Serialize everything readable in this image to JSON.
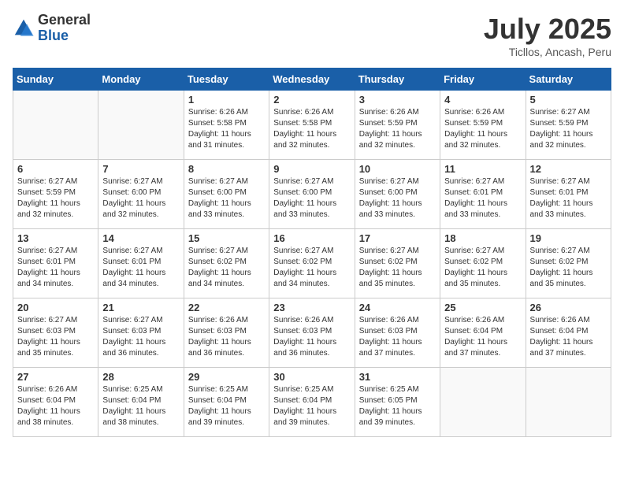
{
  "header": {
    "logo": {
      "general": "General",
      "blue": "Blue"
    },
    "title": "July 2025",
    "subtitle": "Ticllos, Ancash, Peru"
  },
  "calendar": {
    "days_of_week": [
      "Sunday",
      "Monday",
      "Tuesday",
      "Wednesday",
      "Thursday",
      "Friday",
      "Saturday"
    ],
    "weeks": [
      [
        {
          "day": "",
          "info": ""
        },
        {
          "day": "",
          "info": ""
        },
        {
          "day": "1",
          "info": "Sunrise: 6:26 AM\nSunset: 5:58 PM\nDaylight: 11 hours and 31 minutes."
        },
        {
          "day": "2",
          "info": "Sunrise: 6:26 AM\nSunset: 5:58 PM\nDaylight: 11 hours and 32 minutes."
        },
        {
          "day": "3",
          "info": "Sunrise: 6:26 AM\nSunset: 5:59 PM\nDaylight: 11 hours and 32 minutes."
        },
        {
          "day": "4",
          "info": "Sunrise: 6:26 AM\nSunset: 5:59 PM\nDaylight: 11 hours and 32 minutes."
        },
        {
          "day": "5",
          "info": "Sunrise: 6:27 AM\nSunset: 5:59 PM\nDaylight: 11 hours and 32 minutes."
        }
      ],
      [
        {
          "day": "6",
          "info": "Sunrise: 6:27 AM\nSunset: 5:59 PM\nDaylight: 11 hours and 32 minutes."
        },
        {
          "day": "7",
          "info": "Sunrise: 6:27 AM\nSunset: 6:00 PM\nDaylight: 11 hours and 32 minutes."
        },
        {
          "day": "8",
          "info": "Sunrise: 6:27 AM\nSunset: 6:00 PM\nDaylight: 11 hours and 33 minutes."
        },
        {
          "day": "9",
          "info": "Sunrise: 6:27 AM\nSunset: 6:00 PM\nDaylight: 11 hours and 33 minutes."
        },
        {
          "day": "10",
          "info": "Sunrise: 6:27 AM\nSunset: 6:00 PM\nDaylight: 11 hours and 33 minutes."
        },
        {
          "day": "11",
          "info": "Sunrise: 6:27 AM\nSunset: 6:01 PM\nDaylight: 11 hours and 33 minutes."
        },
        {
          "day": "12",
          "info": "Sunrise: 6:27 AM\nSunset: 6:01 PM\nDaylight: 11 hours and 33 minutes."
        }
      ],
      [
        {
          "day": "13",
          "info": "Sunrise: 6:27 AM\nSunset: 6:01 PM\nDaylight: 11 hours and 34 minutes."
        },
        {
          "day": "14",
          "info": "Sunrise: 6:27 AM\nSunset: 6:01 PM\nDaylight: 11 hours and 34 minutes."
        },
        {
          "day": "15",
          "info": "Sunrise: 6:27 AM\nSunset: 6:02 PM\nDaylight: 11 hours and 34 minutes."
        },
        {
          "day": "16",
          "info": "Sunrise: 6:27 AM\nSunset: 6:02 PM\nDaylight: 11 hours and 34 minutes."
        },
        {
          "day": "17",
          "info": "Sunrise: 6:27 AM\nSunset: 6:02 PM\nDaylight: 11 hours and 35 minutes."
        },
        {
          "day": "18",
          "info": "Sunrise: 6:27 AM\nSunset: 6:02 PM\nDaylight: 11 hours and 35 minutes."
        },
        {
          "day": "19",
          "info": "Sunrise: 6:27 AM\nSunset: 6:02 PM\nDaylight: 11 hours and 35 minutes."
        }
      ],
      [
        {
          "day": "20",
          "info": "Sunrise: 6:27 AM\nSunset: 6:03 PM\nDaylight: 11 hours and 35 minutes."
        },
        {
          "day": "21",
          "info": "Sunrise: 6:27 AM\nSunset: 6:03 PM\nDaylight: 11 hours and 36 minutes."
        },
        {
          "day": "22",
          "info": "Sunrise: 6:26 AM\nSunset: 6:03 PM\nDaylight: 11 hours and 36 minutes."
        },
        {
          "day": "23",
          "info": "Sunrise: 6:26 AM\nSunset: 6:03 PM\nDaylight: 11 hours and 36 minutes."
        },
        {
          "day": "24",
          "info": "Sunrise: 6:26 AM\nSunset: 6:03 PM\nDaylight: 11 hours and 37 minutes."
        },
        {
          "day": "25",
          "info": "Sunrise: 6:26 AM\nSunset: 6:04 PM\nDaylight: 11 hours and 37 minutes."
        },
        {
          "day": "26",
          "info": "Sunrise: 6:26 AM\nSunset: 6:04 PM\nDaylight: 11 hours and 37 minutes."
        }
      ],
      [
        {
          "day": "27",
          "info": "Sunrise: 6:26 AM\nSunset: 6:04 PM\nDaylight: 11 hours and 38 minutes."
        },
        {
          "day": "28",
          "info": "Sunrise: 6:25 AM\nSunset: 6:04 PM\nDaylight: 11 hours and 38 minutes."
        },
        {
          "day": "29",
          "info": "Sunrise: 6:25 AM\nSunset: 6:04 PM\nDaylight: 11 hours and 39 minutes."
        },
        {
          "day": "30",
          "info": "Sunrise: 6:25 AM\nSunset: 6:04 PM\nDaylight: 11 hours and 39 minutes."
        },
        {
          "day": "31",
          "info": "Sunrise: 6:25 AM\nSunset: 6:05 PM\nDaylight: 11 hours and 39 minutes."
        },
        {
          "day": "",
          "info": ""
        },
        {
          "day": "",
          "info": ""
        }
      ]
    ]
  }
}
